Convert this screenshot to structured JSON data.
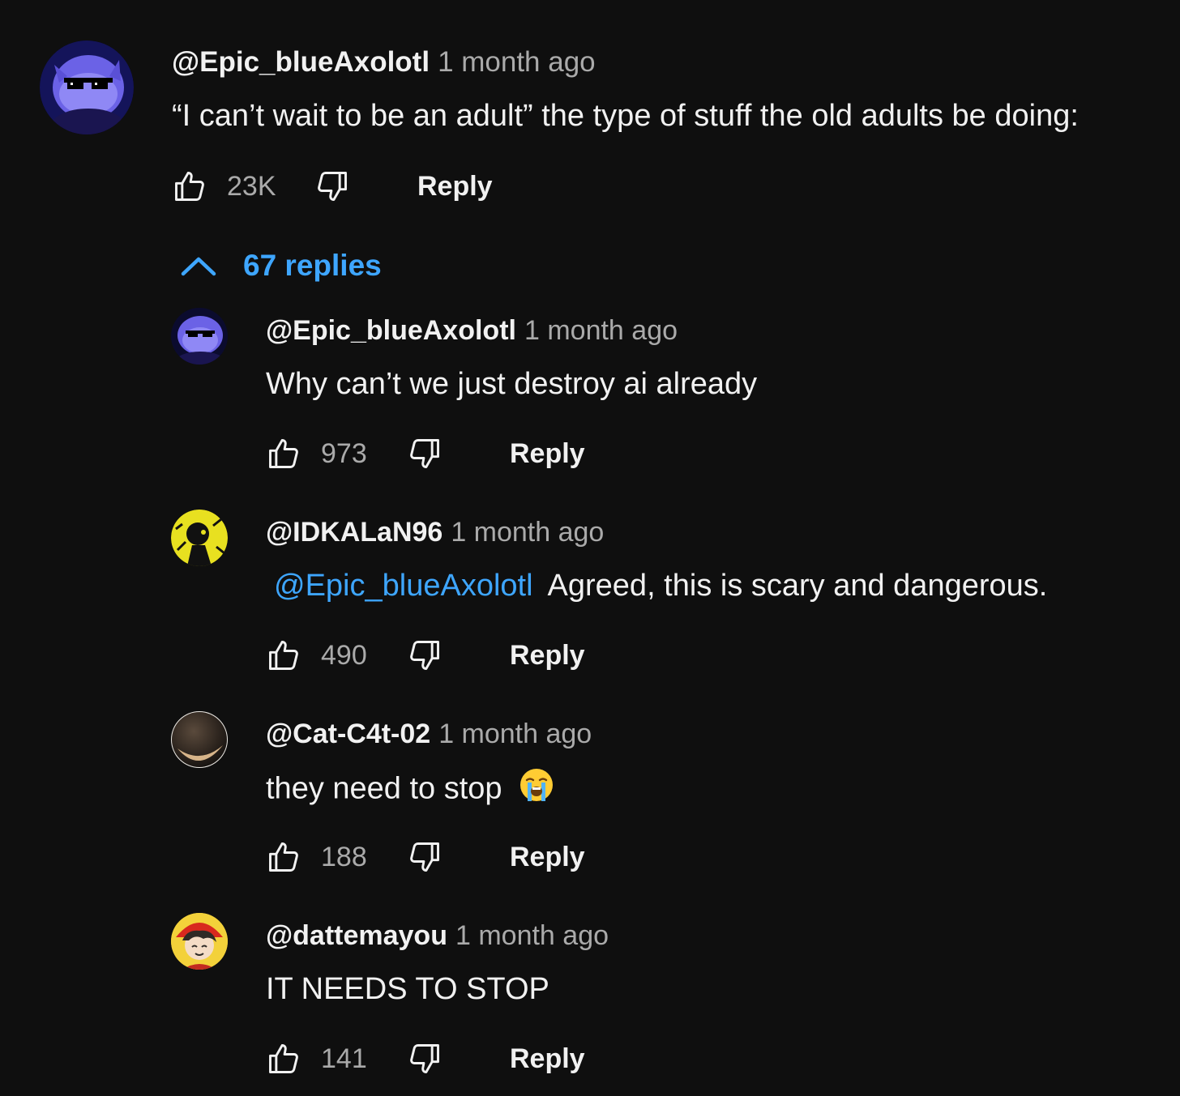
{
  "top_comment": {
    "author": "@Epic_blueAxolotl",
    "time": "1 month ago",
    "text": "“I can’t wait to be an adult” the type of stuff the old adults be doing:",
    "likes": "23K",
    "reply_label": "Reply"
  },
  "replies_toggle": {
    "label": "67 replies",
    "icon": "chevron-up-icon"
  },
  "replies": [
    {
      "author": "@Epic_blueAxolotl",
      "time": "1 month ago",
      "text": "Why can’t we just destroy ai already",
      "likes": "973",
      "reply_label": "Reply"
    },
    {
      "author": "@IDKALaN96",
      "time": "1 month ago",
      "mention": "@Epic_blueAxolotl",
      "text": "Agreed, this is scary and dangerous.",
      "likes": "490",
      "reply_label": "Reply"
    },
    {
      "author": "@Cat-C4t-02",
      "time": "1 month ago",
      "text": "they need to stop",
      "emoji": "loudly-crying-face",
      "likes": "188",
      "reply_label": "Reply"
    },
    {
      "author": "@dattemayou",
      "time": "1 month ago",
      "text": "IT NEEDS TO STOP",
      "likes": "141",
      "reply_label": "Reply"
    }
  ],
  "colors": {
    "background": "#0f0f0f",
    "text": "#f1f1f1",
    "secondary": "#aaaaaa",
    "link": "#3ea6ff"
  }
}
